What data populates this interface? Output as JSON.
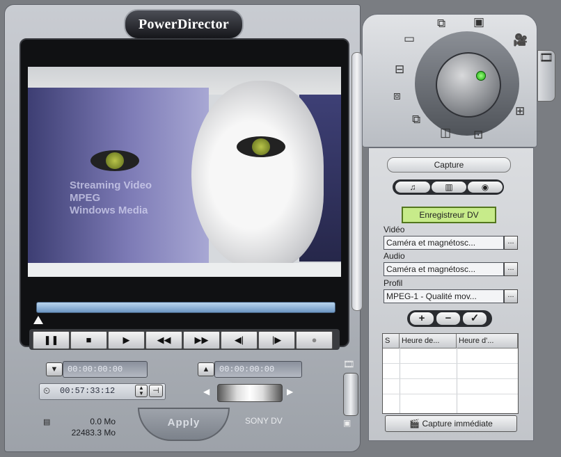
{
  "app": {
    "logo": "PowerDirector"
  },
  "video": {
    "overlay_text": [
      "Streaming Video",
      "MPEG",
      "Windows Media"
    ]
  },
  "transport": {
    "buttons": [
      {
        "icon": "pause-icon",
        "glyph": "❚❚"
      },
      {
        "icon": "stop-icon",
        "glyph": "■"
      },
      {
        "icon": "play-icon",
        "glyph": "▶"
      },
      {
        "icon": "rewind-icon",
        "glyph": "◀◀"
      },
      {
        "icon": "fast-forward-icon",
        "glyph": "▶▶"
      },
      {
        "icon": "previous-frame-icon",
        "glyph": "◀|"
      },
      {
        "icon": "next-frame-icon",
        "glyph": "|▶"
      },
      {
        "icon": "record-icon",
        "glyph": "●"
      }
    ]
  },
  "timecodes": {
    "mark_in": "00:00:00:00",
    "mark_out": "00:00:00:00",
    "duration": "00:57:33:12"
  },
  "info": {
    "size_value": "0.0 Mo",
    "free_value": "22483.3 Mo",
    "device": "SONY DV"
  },
  "apply_label": "Apply",
  "capture": {
    "title": "Capture",
    "source_button": "Enregistreur DV",
    "video_label": "Vidéo",
    "video_value": "Caméra et magnétosc...",
    "audio_label": "Audio",
    "audio_value": "Caméra et magnétosc...",
    "profile_label": "Profil",
    "profile_value": "MPEG-1 - Qualité mov...",
    "dots": "...",
    "columns": [
      "S",
      "Heure de...",
      "Heure d'..."
    ],
    "capture_now": "Capture immédiate"
  },
  "colors": {
    "led": "#17a80c",
    "dv_button": "#c7eb8a",
    "seek": "#6c96c2"
  }
}
